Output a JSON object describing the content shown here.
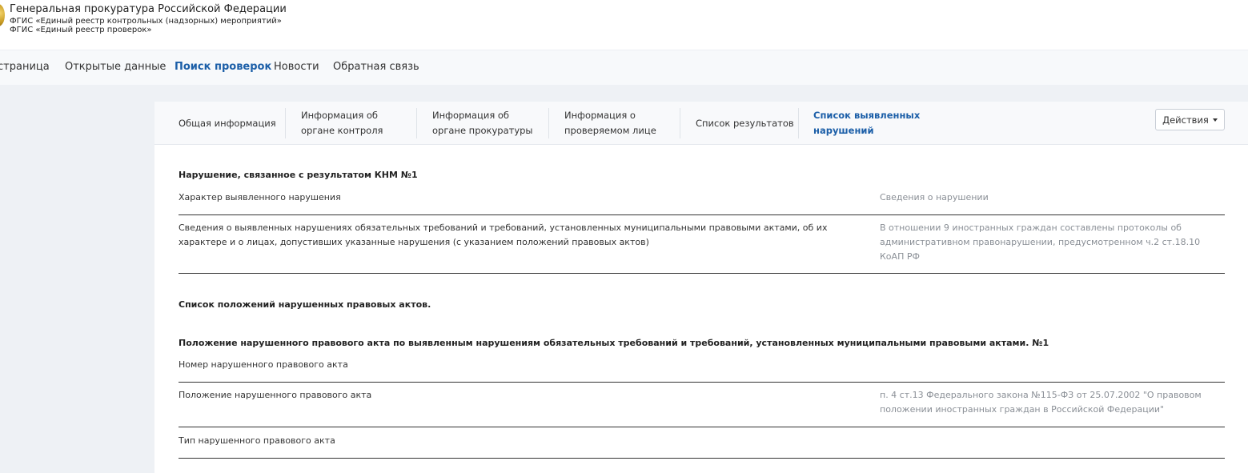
{
  "header": {
    "title": "Генеральная прокуратура Российской Федерации",
    "subtitle1": "ФГИС «Единый реестр контрольных (надзорных) мероприятий»",
    "subtitle2": "ФГИС «Единый реестр проверок»"
  },
  "nav": {
    "items": [
      "страница",
      "Открытые данные",
      "Поиск проверок",
      "Новости",
      "Обратная связь"
    ]
  },
  "tabs": {
    "items": [
      {
        "line1": "Общая информация",
        "line2": ""
      },
      {
        "line1": "Информация об",
        "line2": "органе контроля"
      },
      {
        "line1": "Информация об",
        "line2": "органе прокуратуры"
      },
      {
        "line1": "Информация о",
        "line2": "проверяемом лице"
      },
      {
        "line1": "Список результатов",
        "line2": ""
      },
      {
        "line1": "Список выявленных",
        "line2": "нарушений"
      }
    ],
    "actions_label": "Действия"
  },
  "violation": {
    "title": "Нарушение, связанное с результатом КНМ №1",
    "col_left": "Характер выявленного нарушения",
    "col_right": "Сведения о нарушении",
    "row_label": "Сведения о выявленных нарушениях обязательных требований и требований, установленных муниципальными правовыми актами, об их характере и о лицах, допустивших указанные нарушения (с указанием положений правовых актов)",
    "row_value": "В отношении 9 иностранных граждан составлены протоколы об административном правонарушении, предусмотренном ч.2 ст.18.10 КоАП РФ"
  },
  "acts": {
    "list_title": "Список положений нарушенных правовых актов.",
    "item_title": "Положение нарушенного правового акта по выявленным нарушениям обязательных требований и требований, установленных муниципальными правовыми актами. №1",
    "number_label": "Номер нарушенного правового акта",
    "position_label": "Положение нарушенного правового акта",
    "position_value": "п. 4 ст.13 Федерального закона №115-ФЗ от 25.07.2002 \"О правовом положении иностранных граждан в Российской Федерации\"",
    "type_label": "Тип нарушенного правового акта"
  }
}
